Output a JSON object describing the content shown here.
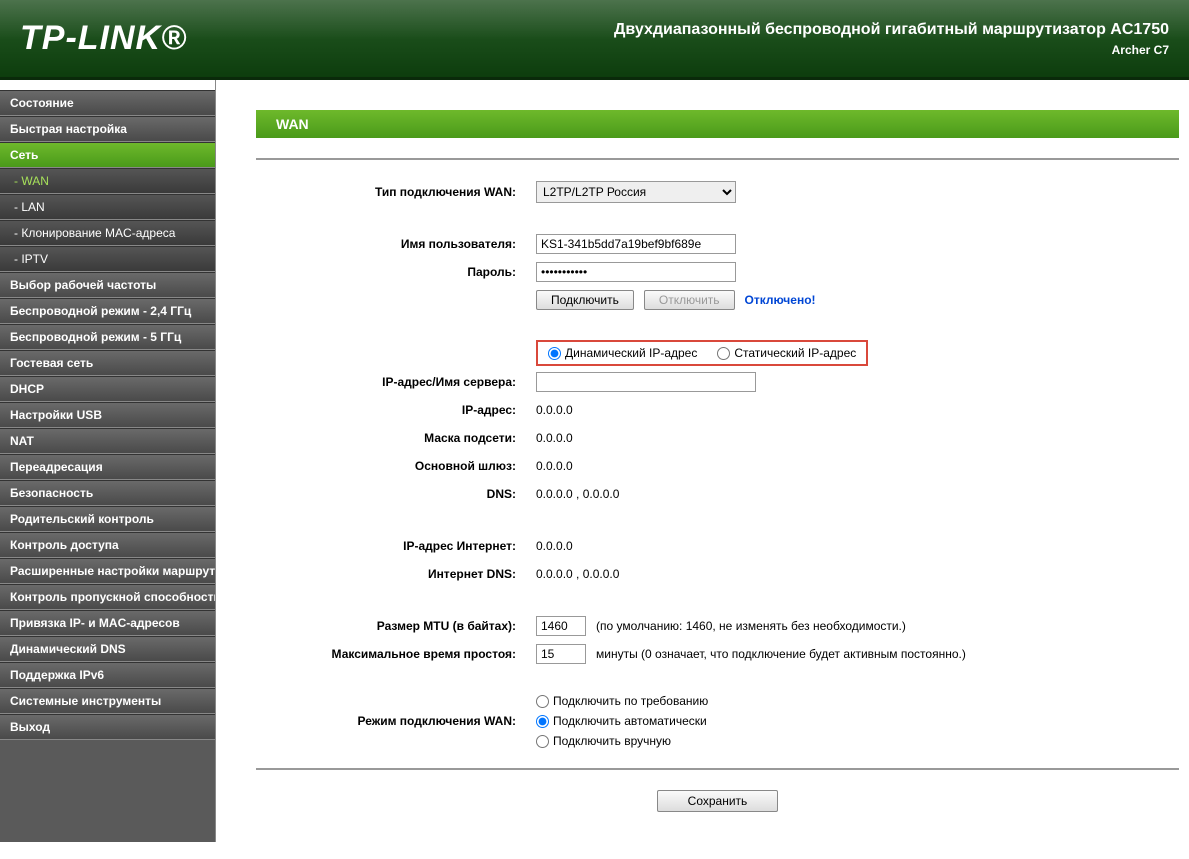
{
  "header": {
    "logo": "TP-LINK®",
    "title": "Двухдиапазонный беспроводной гигабитный маршрутизатор AC1750",
    "model": "Archer C7"
  },
  "nav": {
    "items": [
      {
        "label": "Состояние"
      },
      {
        "label": "Быстрая настройка"
      },
      {
        "label": "Сеть",
        "active": true
      },
      {
        "label": "- WAN",
        "sub": true,
        "activeSub": true
      },
      {
        "label": "- LAN",
        "sub": true
      },
      {
        "label": "- Клонирование MAC-адреса",
        "sub": true
      },
      {
        "label": "- IPTV",
        "sub": true
      },
      {
        "label": "Выбор рабочей частоты"
      },
      {
        "label": "Беспроводной режим - 2,4 ГГц"
      },
      {
        "label": "Беспроводной режим - 5 ГГц"
      },
      {
        "label": "Гостевая сеть"
      },
      {
        "label": "DHCP"
      },
      {
        "label": "Настройки USB"
      },
      {
        "label": "NAT"
      },
      {
        "label": "Переадресация"
      },
      {
        "label": "Безопасность"
      },
      {
        "label": "Родительский контроль"
      },
      {
        "label": "Контроль доступа"
      },
      {
        "label": "Расширенные настройки маршрутизации"
      },
      {
        "label": "Контроль пропускной способности"
      },
      {
        "label": "Привязка IP- и MAC-адресов"
      },
      {
        "label": "Динамический DNS"
      },
      {
        "label": "Поддержка IPv6"
      },
      {
        "label": "Системные инструменты"
      },
      {
        "label": "Выход"
      }
    ]
  },
  "page": {
    "title": "WAN",
    "labels": {
      "wan_type": "Тип подключения WAN:",
      "username": "Имя пользователя:",
      "password": "Пароль:",
      "server": "IP-адрес/Имя сервера:",
      "ip": "IP-адрес:",
      "netmask": "Маска подсети:",
      "gateway": "Основной шлюз:",
      "dns": "DNS:",
      "internet_ip": "IP-адрес Интернет:",
      "internet_dns": "Интернет DNS:",
      "mtu": "Размер MTU (в байтах):",
      "idle": "Максимальное время простоя:",
      "conn_mode": "Режим подключения WAN:"
    },
    "wan_type_value": "L2TP/L2TP Россия",
    "username_value": "KS1-341b5dd7a19bef9bf689e",
    "password_value": "•••••••••••",
    "connect_btn": "Подключить",
    "disconnect_btn": "Отключить",
    "status": "Отключено!",
    "ip_mode": {
      "dynamic": "Динамический IP-адрес",
      "static": "Статический IP-адрес"
    },
    "server_value": "",
    "ip_value": "0.0.0.0",
    "netmask_value": "0.0.0.0",
    "gateway_value": "0.0.0.0",
    "dns_value": "0.0.0.0 , 0.0.0.0",
    "internet_ip_value": "0.0.0.0",
    "internet_dns_value": "0.0.0.0 , 0.0.0.0",
    "mtu_value": "1460",
    "mtu_hint": "(по умолчанию: 1460, не изменять без необходимости.)",
    "idle_value": "15",
    "idle_hint": "минуты (0 означает, что подключение будет активным постоянно.)",
    "conn_modes": {
      "on_demand": "Подключить по требованию",
      "auto": "Подключить автоматически",
      "manual": "Подключить вручную"
    },
    "save_btn": "Сохранить"
  }
}
